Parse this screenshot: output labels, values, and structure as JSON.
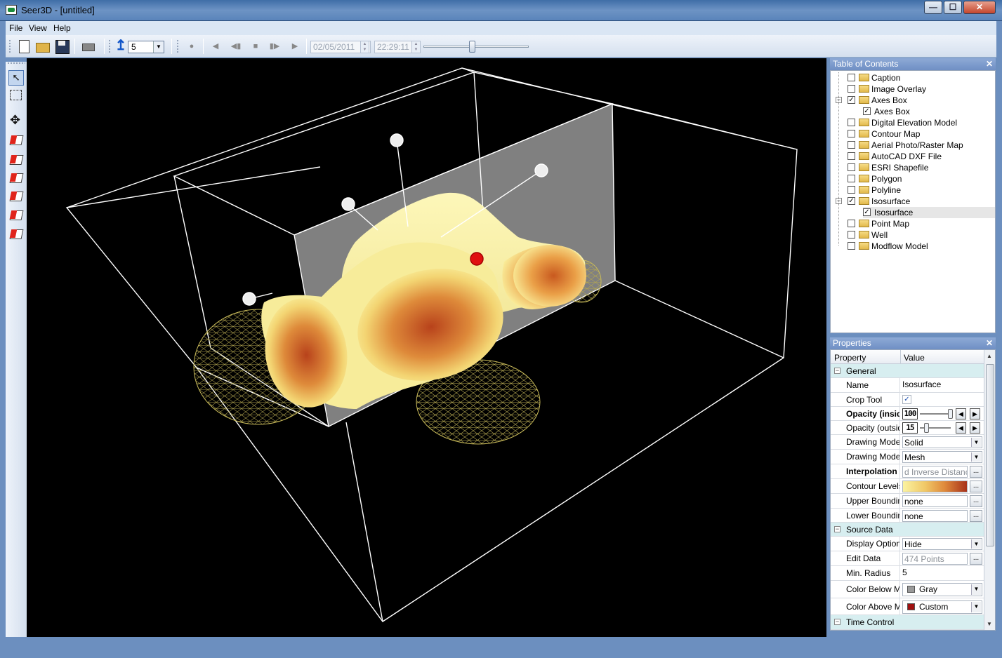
{
  "window": {
    "title": "Seer3D - [untitled]",
    "min_label": "—",
    "max_label": "☐",
    "close_label": "✕"
  },
  "menu": {
    "file": "File",
    "view": "View",
    "help": "Help"
  },
  "toolbar": {
    "time_step": "5",
    "date": "02/05/2011",
    "time": "22:29:11",
    "time_slider_fraction": 0.46
  },
  "toc": {
    "title": "Table of Contents",
    "items": [
      {
        "label": "Caption",
        "checked": false,
        "level": 0
      },
      {
        "label": "Image Overlay",
        "checked": false,
        "level": 0
      },
      {
        "label": "Axes Box",
        "checked": true,
        "level": 0,
        "expanded": true
      },
      {
        "label": "Axes Box",
        "checked": true,
        "level": 1
      },
      {
        "label": "Digital Elevation Model",
        "checked": false,
        "level": 0
      },
      {
        "label": "Contour Map",
        "checked": false,
        "level": 0
      },
      {
        "label": "Aerial Photo/Raster Map",
        "checked": false,
        "level": 0
      },
      {
        "label": "AutoCAD DXF File",
        "checked": false,
        "level": 0
      },
      {
        "label": "ESRI Shapefile",
        "checked": false,
        "level": 0
      },
      {
        "label": "Polygon",
        "checked": false,
        "level": 0
      },
      {
        "label": "Polyline",
        "checked": false,
        "level": 0
      },
      {
        "label": "Isosurface",
        "checked": true,
        "level": 0,
        "expanded": true
      },
      {
        "label": "Isosurface",
        "checked": true,
        "level": 1,
        "selected": true
      },
      {
        "label": "Point Map",
        "checked": false,
        "level": 0
      },
      {
        "label": "Well",
        "checked": false,
        "level": 0
      },
      {
        "label": "Modflow Model",
        "checked": false,
        "level": 0
      }
    ]
  },
  "properties": {
    "title": "Properties",
    "col_property": "Property",
    "col_value": "Value",
    "groups": {
      "general": "General",
      "source": "Source Data",
      "time": "Time Control"
    },
    "rows": {
      "name": {
        "label": "Name",
        "value": "Isosurface"
      },
      "crop": {
        "label": "Crop Tool",
        "value": "✓"
      },
      "opacity_in": {
        "label": "Opacity (inside o",
        "value": "100",
        "level": 1.0
      },
      "opacity_out": {
        "label": "Opacity (outside",
        "value": "15",
        "level": 0.15
      },
      "draw_in": {
        "label": "Drawing Mode (",
        "value": "Solid"
      },
      "draw_out": {
        "label": "Drawing Mode (",
        "value": "Mesh"
      },
      "interp": {
        "label": "Interpolation Par",
        "value": "d Inverse Distance"
      },
      "contour": {
        "label": "Contour Levels"
      },
      "upper": {
        "label": "Upper Bounding",
        "value": "none"
      },
      "lower": {
        "label": "Lower Bounding",
        "value": "none"
      },
      "display": {
        "label": "Display Option",
        "value": "Hide"
      },
      "edit": {
        "label": "Edit Data",
        "value": "474 Points"
      },
      "radius": {
        "label": "Min. Radius",
        "value": "5"
      },
      "below": {
        "label": "Color Below Min",
        "value": "Gray",
        "color": "#9a9a9a"
      },
      "above": {
        "label": "Color Above Ma",
        "value": "Custom",
        "color": "#a01010"
      }
    },
    "ellipsis": "..."
  },
  "colors": {
    "selection": "#c3d6ef",
    "group_bg": "#d7eef0",
    "isosurface_inner": "#c2501d",
    "isosurface_outer": "#fbf7a8"
  }
}
